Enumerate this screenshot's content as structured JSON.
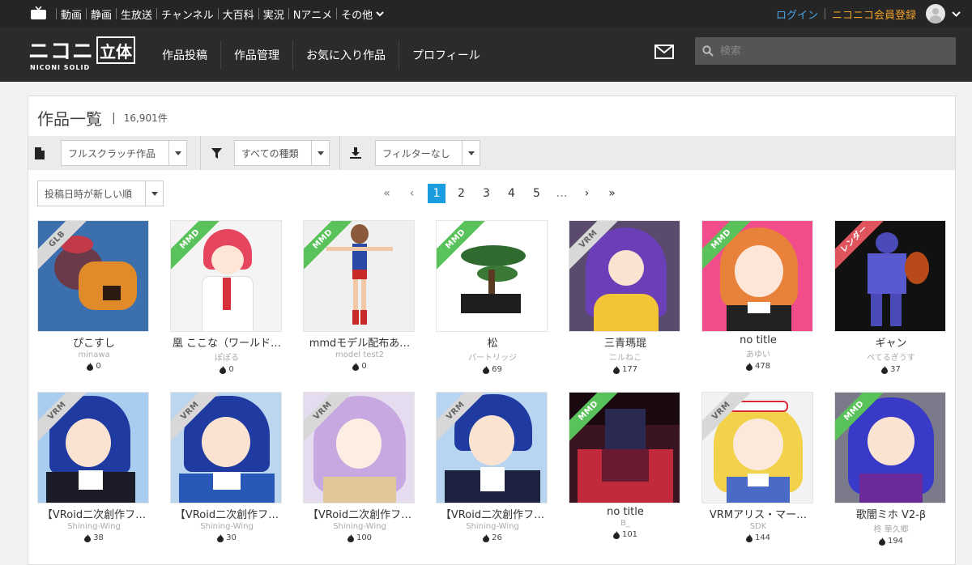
{
  "topnav": {
    "items": [
      "動画",
      "静画",
      "生放送",
      "チャンネル",
      "大百科",
      "実況",
      "Nアニメ",
      "その他"
    ],
    "login": "ログイン",
    "register": "ニコニコ会員登録"
  },
  "header": {
    "brand_main": "ニコニ",
    "brand_box": "立体",
    "brand_sub": "NICONI SOLID",
    "nav": [
      "作品投稿",
      "作品管理",
      "お気に入り作品",
      "プロフィール"
    ],
    "search_placeholder": "検索"
  },
  "panel": {
    "title": "作品一覧",
    "count": "16,901件"
  },
  "filters": {
    "scope": "フルスクラッチ作品",
    "kind": "すべての種類",
    "download": "フィルターなし",
    "sort": "投稿日時が新しい順"
  },
  "pager": {
    "first": "«",
    "prev": "‹",
    "pages": [
      "1",
      "2",
      "3",
      "4",
      "5"
    ],
    "ellipsis": "…",
    "next": "›",
    "last": "»",
    "current": 1
  },
  "colors": {
    "accent": "#1a9de0",
    "mmd_ribbon": "#5ac25a",
    "render_ribbon": "#e0555d",
    "login": "#4aa6e8",
    "register": "#f0a028"
  },
  "works": [
    {
      "badge": "GLB",
      "title": "ぴこすし",
      "author": "minawa",
      "count": "0",
      "bg": "#3b6fae"
    },
    {
      "badge": "MMD",
      "title": "凰 ここな（ワールド…",
      "author": "ぽぽる",
      "count": "0",
      "bg": "#f4f4f4"
    },
    {
      "badge": "MMD",
      "title": "mmdモデル配布あ…",
      "author": "model test2",
      "count": "0",
      "bg": "#f0f0f0"
    },
    {
      "badge": "MMD",
      "title": "松",
      "author": "パートリッジ",
      "count": "69",
      "bg": "#ffffff"
    },
    {
      "badge": "VRM",
      "title": "三青瑪琨",
      "author": "ニルねこ",
      "count": "177",
      "bg": "#5a4a6e"
    },
    {
      "badge": "MMD",
      "title": "no title",
      "author": "あゆい",
      "count": "478",
      "bg": "#f04d8a"
    },
    {
      "badge": "レンダー",
      "title": "ギャン",
      "author": "ぺてるぎうす",
      "count": "37",
      "bg": "#111111"
    },
    {
      "badge": "VRM",
      "title": "【VRoid二次創作フ…",
      "author": "Shining-Wing",
      "count": "38",
      "bg": "#a9cdf0"
    },
    {
      "badge": "VRM",
      "title": "【VRoid二次創作フ…",
      "author": "Shining-Wing",
      "count": "30",
      "bg": "#bcd6f0"
    },
    {
      "badge": "VRM",
      "title": "【VRoid二次創作フ…",
      "author": "Shining-Wing",
      "count": "100",
      "bg": "#e6dcef"
    },
    {
      "badge": "VRM",
      "title": "【VRoid二次創作フ…",
      "author": "Shining-Wing",
      "count": "26",
      "bg": "#b7d4f0"
    },
    {
      "badge": "MMD",
      "title": "no title",
      "author": "B_",
      "count": "101",
      "bg": "#3a1420"
    },
    {
      "badge": "VRM",
      "title": "VRMアリス・マー…",
      "author": "SDK",
      "count": "144",
      "bg": "#f2f2f2"
    },
    {
      "badge": "MMD",
      "title": "歌闇ミホ V2-β",
      "author": "柊 華久郷",
      "count": "194",
      "bg": "#7a7a8a"
    }
  ]
}
